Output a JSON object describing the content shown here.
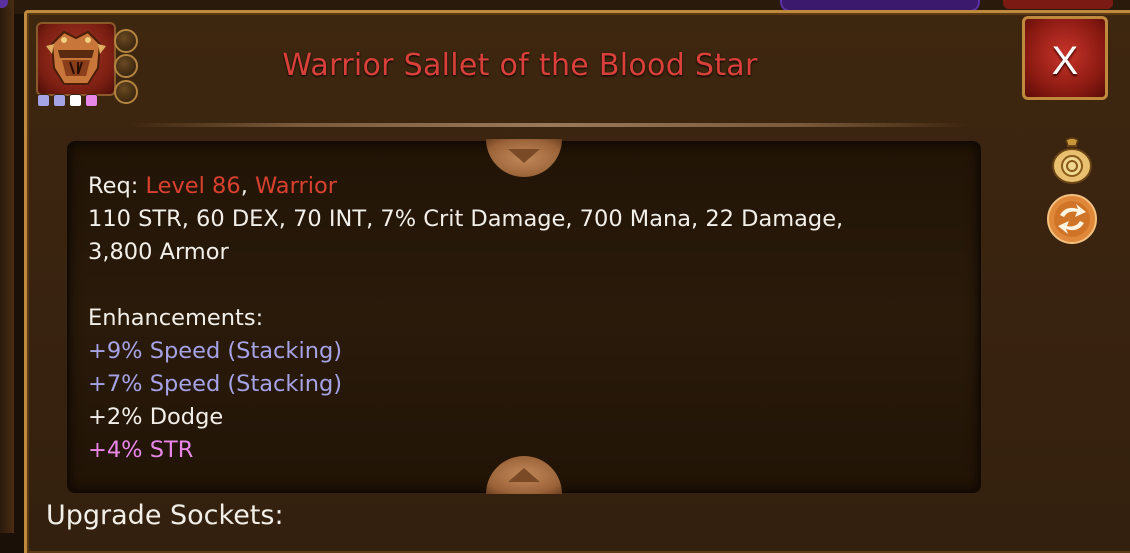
{
  "item": {
    "title": "Warrior Sallet of the Blood Star",
    "icon": "helmet-icon",
    "rarity_pips": [
      "#a6a2e6",
      "#a6a2e6",
      "#ffffff",
      "#e887e8"
    ],
    "title_color": "#d9403a"
  },
  "close_button": {
    "label": "X"
  },
  "side_icons": [
    "gold-bag-icon",
    "swap-icon"
  ],
  "requirements": {
    "prefix": "Req:",
    "level": "Level 86",
    "separator": ",",
    "class": "Warrior",
    "stats_line1": "110 STR, 60 DEX, 70 INT, 7% Crit Damage, 700 Mana, 22 Damage,",
    "stats_line2": "3,800 Armor"
  },
  "enhancements": {
    "heading": "Enhancements:",
    "items": [
      {
        "text": "+9% Speed (Stacking)",
        "color": "#a6a2e6"
      },
      {
        "text": "+7% Speed (Stacking)",
        "color": "#a6a2e6"
      },
      {
        "text": "+2% Dodge",
        "color": "#f2efe8"
      },
      {
        "text": "+4% STR",
        "color": "#e887e8"
      }
    ]
  },
  "upgrade_sockets": {
    "label": "Upgrade Sockets:"
  }
}
